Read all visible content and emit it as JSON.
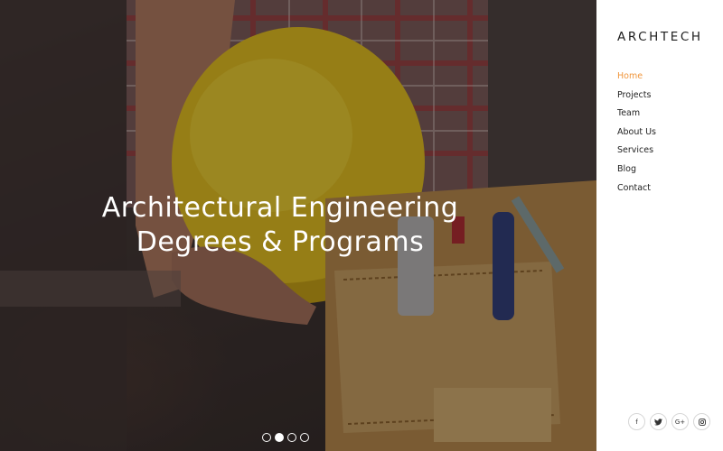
{
  "brand": {
    "logo": "ARCHTECH"
  },
  "nav": {
    "items": [
      {
        "label": "Home",
        "active": true
      },
      {
        "label": "Projects"
      },
      {
        "label": "Team"
      },
      {
        "label": "About Us"
      },
      {
        "label": "Services"
      },
      {
        "label": "Blog"
      },
      {
        "label": "Contact"
      }
    ]
  },
  "hero": {
    "title_line1": "Architectural Engineering",
    "title_line2": "Degrees & Programs",
    "slides": 4,
    "active_slide": 2
  },
  "social": [
    {
      "icon": "facebook-icon",
      "glyph": "f"
    },
    {
      "icon": "twitter-icon",
      "glyph": "✓"
    },
    {
      "icon": "google-plus-icon",
      "glyph": "G+"
    },
    {
      "icon": "instagram-icon",
      "glyph": "◎"
    }
  ],
  "colors": {
    "accent": "#f0963c",
    "text": "#222222"
  }
}
